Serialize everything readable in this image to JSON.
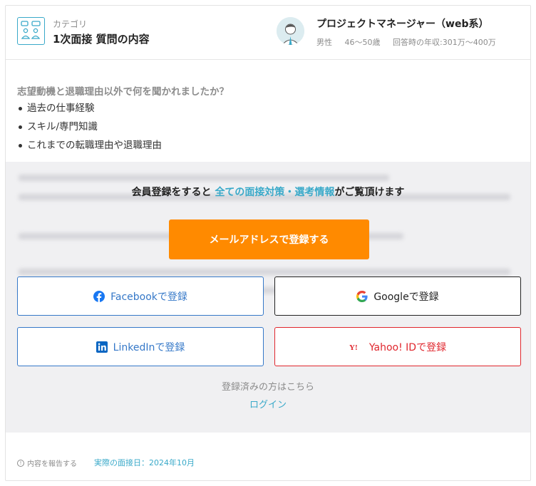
{
  "header": {
    "category_sub": "カテゴリ",
    "category_title": "1次面接 質問の内容",
    "job_title": "プロジェクトマネージャー（web系）",
    "meta": {
      "gender": "男性",
      "age": "46〜50歳",
      "salary": "回答時の年収:301万〜400万"
    }
  },
  "question": {
    "title": "志望動機と退職理由以外で何を聞かれましたか？",
    "bullets": [
      "過去の仕事経験",
      "スキル/専門知識",
      "これまでの転職理由や退職理由"
    ]
  },
  "gate": {
    "msg_pre": "会員登録をすると",
    "msg_highlight": "全ての面接対策・選考情報",
    "msg_post": "がご覧頂けます",
    "email_button": "メールアドレスで登録する",
    "facebook_button": "Facebookで登録",
    "google_button": "Googleで登録",
    "linkedin_button": "LinkedInで登録",
    "yahoo_button": "Yahoo! IDで登録",
    "already": "登録済みの方はこちら",
    "login": "ログイン"
  },
  "footer": {
    "report": "内容を報告する",
    "interview_date": "実際の面接日：2024年10月"
  },
  "colors": {
    "accent": "#39a9c9",
    "orange": "#ff8a00",
    "facebook": "#3578c8",
    "yahoo": "#e0262d"
  }
}
